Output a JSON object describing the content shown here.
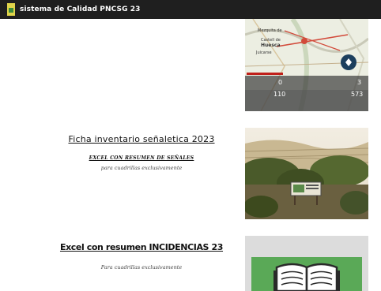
{
  "header": {
    "site_title": "sistema de Calidad PNCSG 23"
  },
  "map_card": {
    "labels": {
      "place1": "Mezquita de",
      "place2": "Castell de",
      "place3": "Huesca",
      "place4": "Juicarse",
      "stat_left": "0",
      "stat_mid": "110",
      "stat_right": "3",
      "stat_far": "573"
    }
  },
  "card_signage": {
    "title": "Ficha inventario señaletica 2023",
    "link": "EXCEL CON RESUMEN DE SEÑALES",
    "note": "para cuadrillas exclusivamente"
  },
  "card_incidents": {
    "title": "Excel con resumen INCIDENCIAS 23",
    "note": "Para cuadrillas exclusivamente"
  },
  "colors": {
    "topbar": "#1f1f1f",
    "book_bg": "#5aa957",
    "card_gray": "#dcdcdc"
  }
}
